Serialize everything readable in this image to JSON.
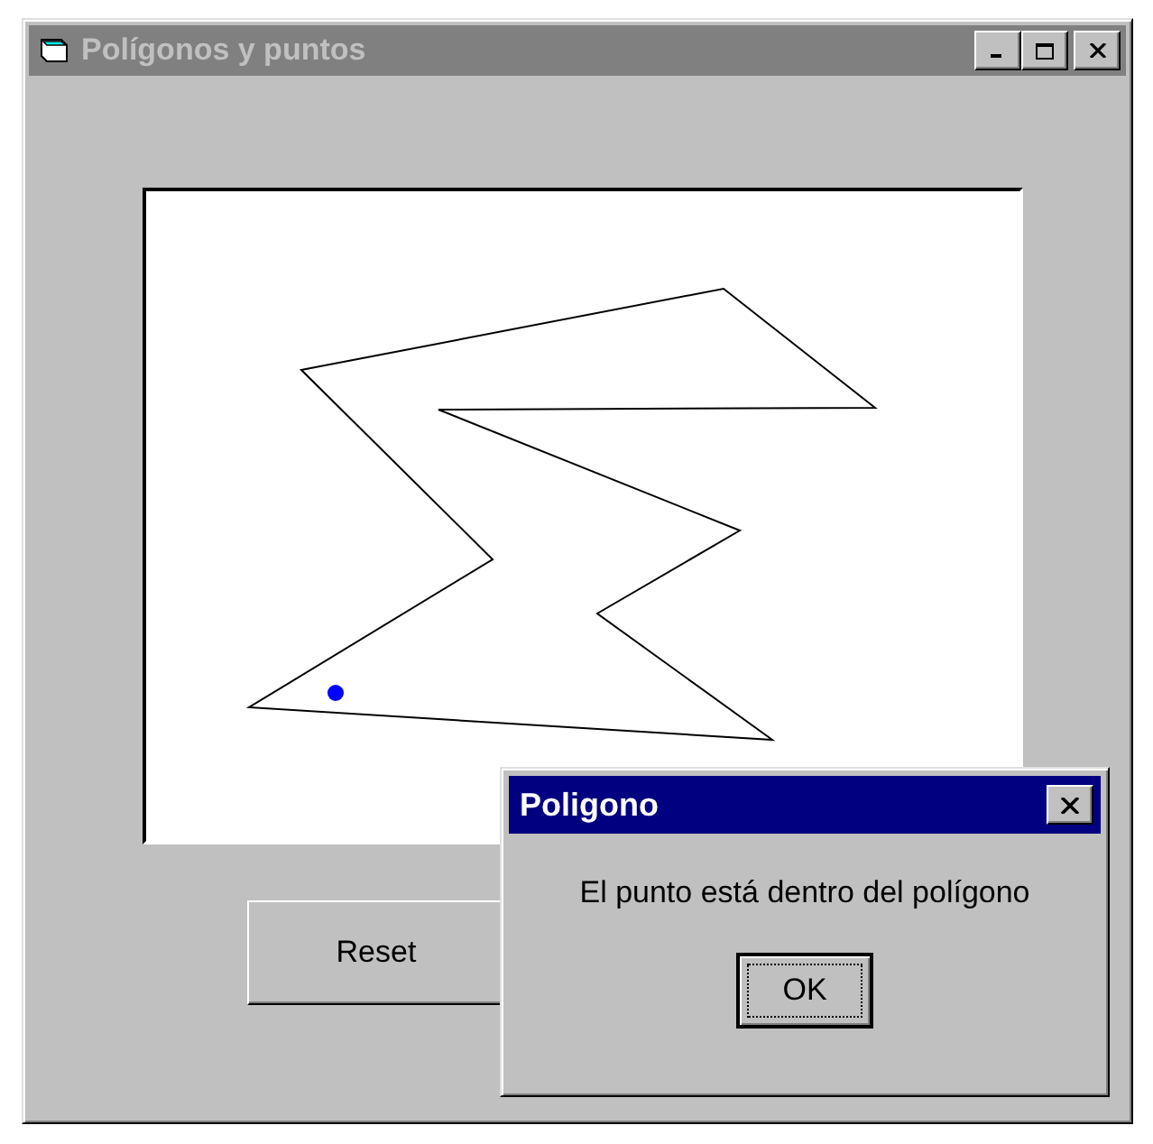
{
  "window": {
    "title": "Polígonos y puntos",
    "active": false
  },
  "buttons": [
    "Reset"
  ],
  "dialog": {
    "title": "Poligono",
    "active": true,
    "message": "El punto está dentro del polígono",
    "buttons": [
      "OK"
    ]
  }
}
